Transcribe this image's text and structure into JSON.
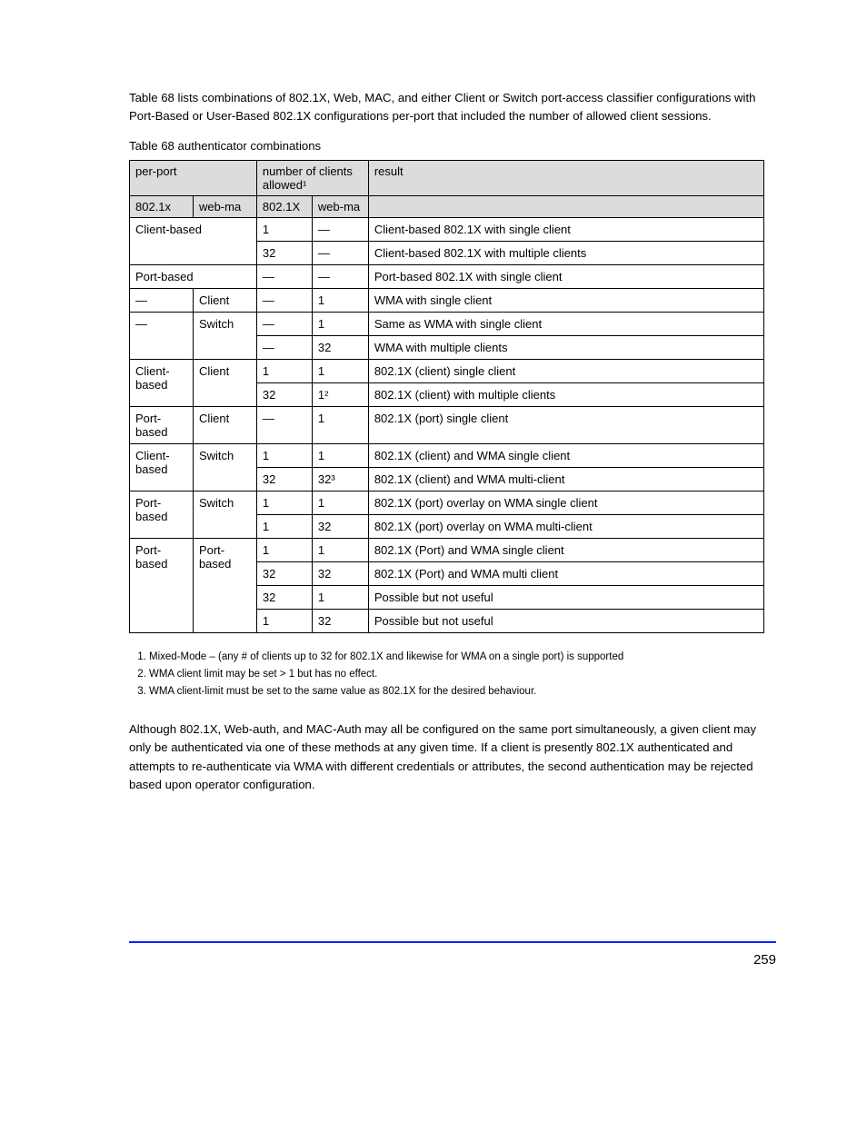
{
  "intro": "Table 68 lists combinations of 802.1X, Web, MAC, and either Client or Switch port-access classifier configurations with Port-Based or User-Based 802.1X configurations per-port that included the number of allowed client sessions.",
  "table_title": "Table 68   authenticator combinations",
  "headers": {
    "group1": "per-port",
    "group2": "number of clients allowed¹",
    "result": "result",
    "h1": "802.1x",
    "h2": "web-ma",
    "h3": "802.1X",
    "h4": "web-ma"
  },
  "rows": [
    {
      "c1": {
        "text": "Client-based",
        "rowspan": 2,
        "colspan": 2
      },
      "c3": "1",
      "c4": "—",
      "c5": "Client-based 802.1X with single client"
    },
    {
      "c3": "32",
      "c4": "—",
      "c5": "Client-based 802.1X with multiple clients"
    },
    {
      "c1": {
        "text": "Port-based",
        "colspan": 2
      },
      "c3": "—",
      "c4": "—",
      "c5": "Port-based 802.1X with single client"
    },
    {
      "c1": "—",
      "c2": "Client",
      "c3": "—",
      "c4": "1",
      "c5": "WMA with single client"
    },
    {
      "c1": {
        "text": "—",
        "rowspan": 2
      },
      "c2": {
        "text": "Switch",
        "rowspan": 2
      },
      "c3": "—",
      "c4": "1",
      "c5": "Same as WMA with single client"
    },
    {
      "c3": "—",
      "c4": "32",
      "c5": "WMA with multiple clients"
    },
    {
      "c1": {
        "text": "Client-based",
        "rowspan": 2
      },
      "c2": {
        "text": "Client",
        "rowspan": 2
      },
      "c3": "1",
      "c4": "1",
      "c5": "802.1X (client) single client"
    },
    {
      "c3": "32",
      "c4": "1²",
      "c5": "802.1X (client) with multiple clients"
    },
    {
      "c1": "Port-based",
      "c2": "Client",
      "c3": "—",
      "c4": "1",
      "c5": "802.1X (port) single client"
    },
    {
      "c1": {
        "text": "Client-based",
        "rowspan": 2
      },
      "c2": {
        "text": "Switch",
        "rowspan": 2
      },
      "c3": "1",
      "c4": "1",
      "c5": "802.1X (client) and WMA single client"
    },
    {
      "c3": "32",
      "c4": "32³",
      "c5": "802.1X (client) and WMA multi-client"
    },
    {
      "c1": {
        "text": "Port-based",
        "rowspan": 2
      },
      "c2": {
        "text": "Switch",
        "rowspan": 2
      },
      "c3": "1",
      "c4": "1",
      "c5": "802.1X (port) overlay on WMA single client"
    },
    {
      "c3": "1",
      "c4": "32",
      "c5": "802.1X (port) overlay on WMA multi-client"
    },
    {
      "c1": {
        "text": "Port-based",
        "rowspan": 4
      },
      "c2": {
        "text": "Port-based",
        "rowspan": 4
      },
      "c3": "1",
      "c4": "1",
      "c5": "802.1X (Port) and WMA single client"
    },
    {
      "c3": "32",
      "c4": "32",
      "c5": "802.1X (Port) and WMA multi client"
    },
    {
      "c3": "32",
      "c4": "1",
      "c5": "Possible but not useful"
    },
    {
      "c3": "1",
      "c4": "32",
      "c5": "Possible but not useful"
    }
  ],
  "footnotes": [
    "Mixed-Mode – (any # of clients up to 32 for 802.1X and likewise for WMA on a single port) is supported",
    "WMA client limit may be set > 1 but has no effect.",
    "WMA client-limit must be set to the same value as 802.1X for the desired behaviour."
  ],
  "post_paragraph": "Although 802.1X, Web-auth, and MAC-Auth may all be configured on the same port simultaneously, a given client may only be authenticated via one of these methods at any given time. If a client is presently 802.1X authenticated and attempts to re-authenticate via WMA with different credentials or attributes, the second authentication may be rejected based upon operator configuration.",
  "page_number": "259"
}
